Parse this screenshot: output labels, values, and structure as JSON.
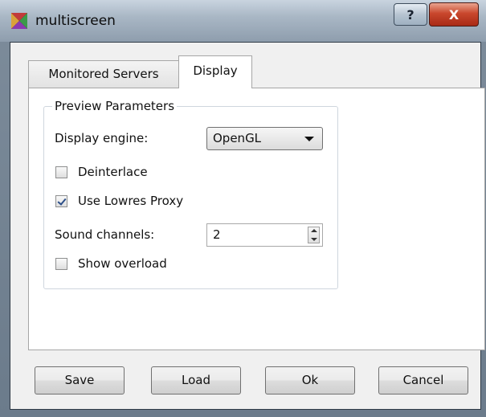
{
  "window": {
    "title": "multiscreen",
    "help_label": "?",
    "close_label": "X"
  },
  "tabs": [
    {
      "label": "Monitored Servers",
      "active": false
    },
    {
      "label": "Display",
      "active": true
    }
  ],
  "preview": {
    "group_title": "Preview Parameters",
    "display_engine_label": "Display engine:",
    "display_engine_value": "OpenGL",
    "deinterlace_label": "Deinterlace",
    "deinterlace_checked": false,
    "lowres_label": "Use Lowres Proxy",
    "lowres_checked": true,
    "sound_channels_label": "Sound channels:",
    "sound_channels_value": "2",
    "show_overload_label": "Show overload",
    "show_overload_checked": false
  },
  "buttons": {
    "save": "Save",
    "load": "Load",
    "ok": "Ok",
    "cancel": "Cancel"
  },
  "icons": {
    "app": "multiscreen-app-icon",
    "help": "help-icon",
    "close": "close-icon",
    "dropdown": "chevron-down-icon",
    "spin_up": "spin-up-icon",
    "spin_down": "spin-down-icon"
  },
  "colors": {
    "title_bar": "#a9b7c5",
    "close_button": "#c9472d",
    "dialog_bg": "#f0f0f0",
    "check_mark": "#2c4f89"
  }
}
